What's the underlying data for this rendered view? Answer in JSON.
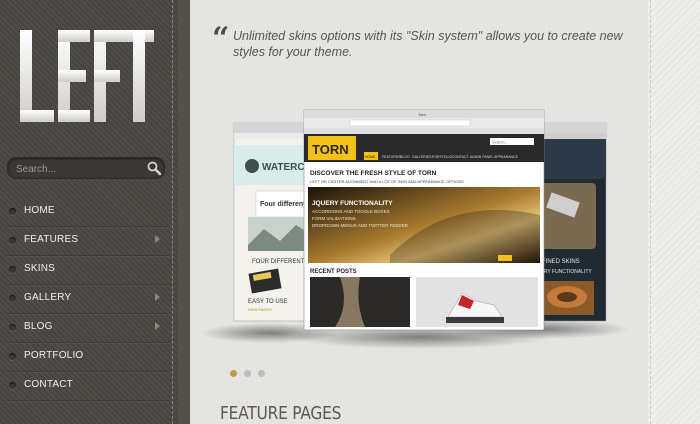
{
  "logo": {
    "text": "LEFT"
  },
  "search": {
    "placeholder": "Search..."
  },
  "nav": [
    {
      "label": "HOME",
      "has_submenu": false
    },
    {
      "label": "FEATURES",
      "has_submenu": true
    },
    {
      "label": "SKINS",
      "has_submenu": false
    },
    {
      "label": "GALLERY",
      "has_submenu": true
    },
    {
      "label": "BLOG",
      "has_submenu": true
    },
    {
      "label": "PORTFOLIO",
      "has_submenu": false
    },
    {
      "label": "CONTACT",
      "has_submenu": false
    }
  ],
  "quote": {
    "text": "Unlimited skins options with its \"Skin system\" allows you to create new styles for your theme."
  },
  "slider": {
    "front": {
      "window_title": "Torn",
      "logo": "TORN",
      "nav": [
        "HOME",
        "FEATURES",
        "BLOG",
        "GALLERIES",
        "PORTFOLIO",
        "CONTACT",
        "ADMIN PANEL",
        "APPEARANCE"
      ],
      "search_placeholder": "Search...",
      "heading": "DISCOVER THE FRESH STYLE OF TORN",
      "subheading": "LEFT OR CENTER ALIGNMENT AND A LOT OF SKIN AND APPEARANCE OPTIONS",
      "banner_title": "JQUERY FUNCTIONALITY",
      "banner_lines": [
        "ACCORDIONS AND TOGGLE BOXES",
        "FORM VALIDATIONS",
        "DROPDOWN MENUS AND TWITTER FEEDER"
      ],
      "recent_posts": "RECENT POSTS"
    },
    "left": {
      "logo": "WATERCOLOR",
      "banner": "Four different SK",
      "caption": "FOUR DIFFERENT S",
      "easy": "EASY TO USE",
      "link": "WEB PAGES"
    },
    "right": {
      "caption": "EFINED SKINS",
      "sub": "JERY FUNCTIONALITY"
    },
    "active_dot": 0,
    "dot_count": 3
  },
  "colors": {
    "accent": "#f2c21a",
    "sidebar": "#4a4743",
    "dot_active": "#c59a4a",
    "dot_inactive": "#bdbcb8"
  },
  "feature_pages": {
    "title": "FEATURE PAGES"
  }
}
